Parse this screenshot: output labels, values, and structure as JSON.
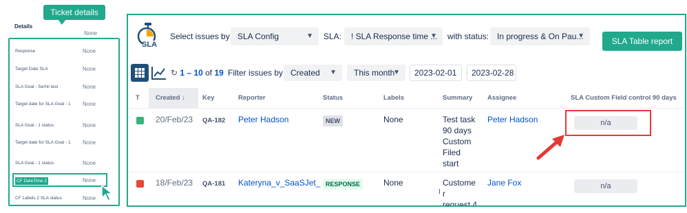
{
  "callouts": {
    "ticket_details": "Ticket details",
    "sla_table_report": "SLA Table report"
  },
  "ticket_panel": {
    "heading": "Details",
    "top_value": "None",
    "rows": [
      {
        "label": "Response",
        "value": "None"
      },
      {
        "label": "Target Date SLA",
        "value": "None"
      },
      {
        "label": "SLA Goal - Serhii test",
        "value": "None"
      },
      {
        "label": "Target date for SLA Goal - 1",
        "value": "None"
      },
      {
        "label": "SLA Goal - 1 status",
        "value": "None"
      },
      {
        "label": "Target date for SLA Goal - 1",
        "value": "None"
      },
      {
        "label": "SLA Goal - 1 status",
        "value": "None"
      },
      {
        "label": "CF DateTime 2",
        "value": "None"
      },
      {
        "label": "CF Labels 2 SLA status",
        "value": "None"
      }
    ]
  },
  "toolbar": {
    "logo_text": "SLA",
    "select_issues_label": "Select issues by:",
    "select_issues_value": "SLA Config",
    "sla_label": "SLA:",
    "sla_value": "! SLA Response time ...",
    "status_label": "with status:",
    "status_value": "In progress & On Pau..."
  },
  "filter_bar": {
    "range_from": "1",
    "range_to": "10",
    "range_sep": " – ",
    "range_of": " of ",
    "range_total": "19",
    "filter_label": "Filter issues by:",
    "filter_field": "Created",
    "period": "This month",
    "date_from": "2023-02-01",
    "date_sep": "-",
    "date_to": "2023-02-28"
  },
  "table": {
    "headers": {
      "type": "T",
      "created": "Created ↓",
      "key": "Key",
      "reporter": "Reporter",
      "status": "Status",
      "labels": "Labels",
      "summary": "Summary",
      "assignee": "Assignee",
      "sla_field": "SLA Custom Field control 90 days"
    },
    "rows": [
      {
        "type_icon": "story-icon",
        "created": "20/Feb/23",
        "key": "QA-182",
        "reporter": "Peter Hadson",
        "status": "NEW",
        "labels": "None",
        "summary_lines": [
          "Test task",
          "90 days",
          "Custom",
          "Filed",
          "start"
        ],
        "assignee": "Peter Hadson",
        "sla_value": "n/a"
      },
      {
        "type_icon": "bug-icon",
        "created": "18/Feb/23",
        "key": "QA-181",
        "reporter": "Kateryna_v_SaaSJet_",
        "status": "RESPONSE",
        "labels": "None",
        "summary_lines": [
          "Custome",
          "r",
          "request 4"
        ],
        "assignee": "Jane Fox",
        "sla_value": "n/a"
      }
    ]
  },
  "colors": {
    "accent_green": "#21a88d",
    "link_blue": "#0052cc",
    "highlight_red": "#e53935",
    "arrow_red": "#e53935"
  }
}
